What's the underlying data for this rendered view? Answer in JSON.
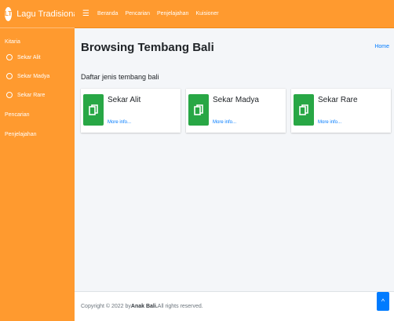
{
  "brand": {
    "logo_text": "LT",
    "title": "Lagu Tradisional"
  },
  "sidebar": {
    "header": "Kitaria",
    "items": [
      {
        "label": "Sekar Alit"
      },
      {
        "label": "Sekar Madya"
      },
      {
        "label": "Sekar Rare"
      }
    ],
    "extra": [
      {
        "label": "Pencarian"
      },
      {
        "label": "Penjelajahan"
      }
    ]
  },
  "navbar": {
    "links": [
      "Beranda",
      "Pencarian",
      "Penjelajahan",
      "Kuisioner"
    ]
  },
  "page": {
    "title": "Browsing Tembang Bali",
    "breadcrumb": "Home",
    "section_label": "Daftar jenis tembang bali"
  },
  "cards": [
    {
      "title": "Sekar Alit",
      "link": "More info..."
    },
    {
      "title": "Sekar Madya",
      "link": "More info..."
    },
    {
      "title": "Sekar Rare",
      "link": "More info..."
    }
  ],
  "footer": {
    "prefix": "Copyright © 2022 by ",
    "author": "Anak Bali.",
    "suffix": " All rights reserved."
  },
  "colors": {
    "sidebar": "#ff9a2f",
    "card_icon": "#28a745",
    "link": "#007bff"
  },
  "icons": {
    "card": "copy-document-icon",
    "back_to_top": "chevron-up-icon",
    "menu": "hamburger-icon"
  }
}
